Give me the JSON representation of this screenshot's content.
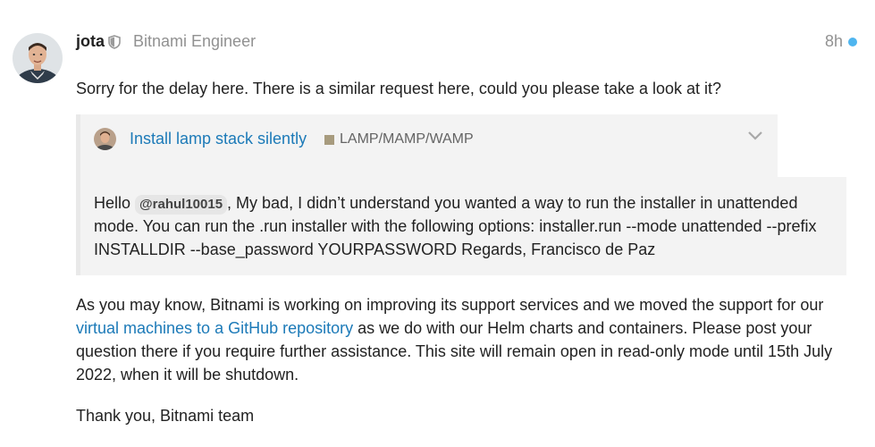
{
  "post": {
    "username": "jota",
    "user_title": "Bitnami Engineer",
    "date": "8h",
    "avatar_icon": "user-avatar-icon",
    "moderator_icon": "shield-icon",
    "unread_color": "#4fb5ef",
    "paragraph_1": "Sorry for the delay here. There is a similar request here, could you please take a look at it?",
    "quote": {
      "title": "Install lamp stack silently",
      "category": "LAMP/MAMP/WAMP",
      "category_color": "#a79b7e",
      "link_color": "#1c7ab8",
      "body_prefix": "Hello ",
      "mention": "@rahul10015",
      "body_suffix": ", My bad, I didn’t understand you wanted a way to run the installer in unattended mode. You can run the .run installer with the following options: installer.run --mode unattended --prefix INSTALLDIR --base_password YOURPASSWORD Regards, Francisco de Paz"
    },
    "paragraph_2": {
      "before_link": "As you may know, Bitnami is working on improving its support services and we moved the support for our ",
      "link_text": "virtual machines to a GitHub repository",
      "after_link": " as we do with our Helm charts and containers. Please post your question there if you require further assistance. This site will remain open in read-only mode until 15th July 2022, when it will be shutdown."
    },
    "paragraph_3": "Thank you, Bitnami team"
  }
}
